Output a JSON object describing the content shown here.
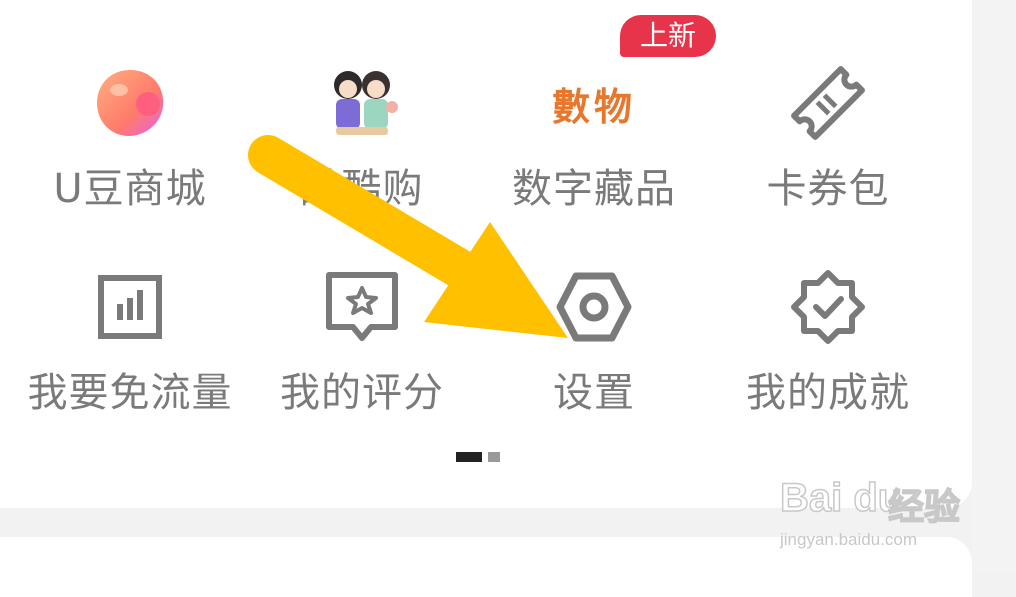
{
  "badge": {
    "text": "上新"
  },
  "grid": {
    "row1": [
      {
        "label": "U豆商城",
        "icon": "orange-bean-icon"
      },
      {
        "label": "酷酷购",
        "icon": "anime-characters-icon"
      },
      {
        "label": "数字藏品",
        "icon": "shuwu-logo-icon",
        "logo_text": "數物"
      },
      {
        "label": "卡券包",
        "icon": "ticket-icon"
      }
    ],
    "row2": [
      {
        "label": "我要免流量",
        "icon": "bar-chart-icon"
      },
      {
        "label": "我的评分",
        "icon": "star-speech-bubble-icon"
      },
      {
        "label": "设置",
        "icon": "hex-settings-icon"
      },
      {
        "label": "我的成就",
        "icon": "achievement-badge-icon"
      }
    ]
  },
  "pagination": {
    "pages": 2,
    "current": 1
  },
  "watermark": {
    "brand": "Bai du",
    "cn": "经验",
    "url": "jingyan.baidu.com"
  },
  "colors": {
    "accent": "#e8344a",
    "icon_gray": "#7a7a7a",
    "arrow": "#ffc000"
  }
}
